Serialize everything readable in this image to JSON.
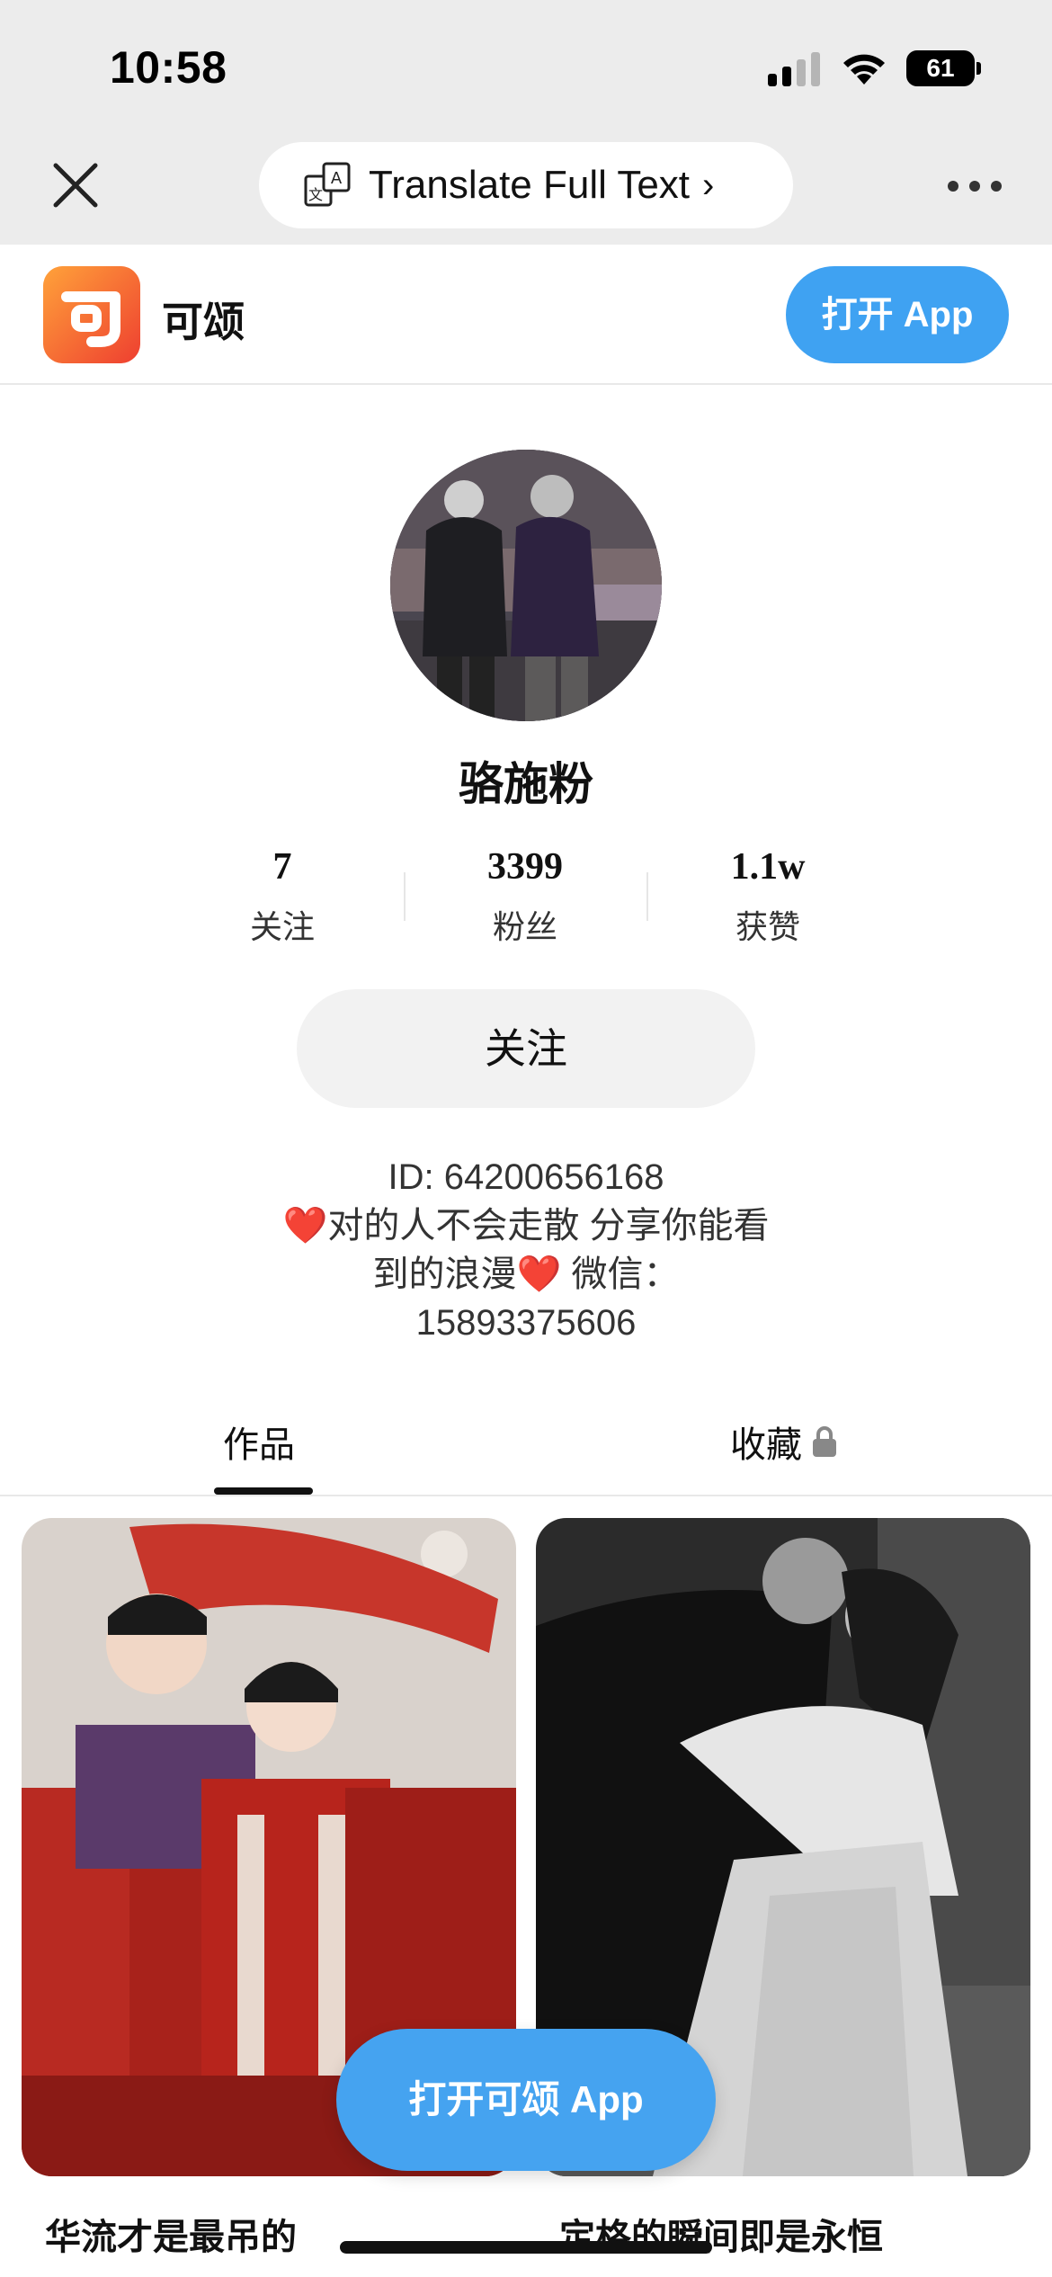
{
  "status_bar": {
    "time": "10:58",
    "battery": "61"
  },
  "browser": {
    "translate_label": "Translate Full Text",
    "translate_chevron": "›"
  },
  "app_header": {
    "app_name": "可颂",
    "open_app_label": "打开 App",
    "accent_color": "#3fa2f2"
  },
  "profile": {
    "username": "骆施粉",
    "stats": [
      {
        "value": "7",
        "label": "关注"
      },
      {
        "value": "3399",
        "label": "粉丝"
      },
      {
        "value": "1.1w",
        "label": "获赞"
      }
    ],
    "follow_label": "关注",
    "bio_lines": [
      "ID: 64200656168",
      "❤️对的人不会走散 分享你能看",
      "到的浪漫❤️ 微信：",
      "15893375606"
    ]
  },
  "tabs": [
    {
      "label": "作品",
      "active": true
    },
    {
      "label": "收藏",
      "locked": true
    }
  ],
  "feed": [
    {
      "title": "华流才是最吊的"
    },
    {
      "title": "定格的瞬间即是永恒"
    }
  ],
  "floating_button": {
    "label": "打开可颂 App"
  },
  "icons": {
    "close": "close-icon",
    "translate": "translate-icon",
    "more": "more-icon",
    "lock": "lock-icon"
  }
}
